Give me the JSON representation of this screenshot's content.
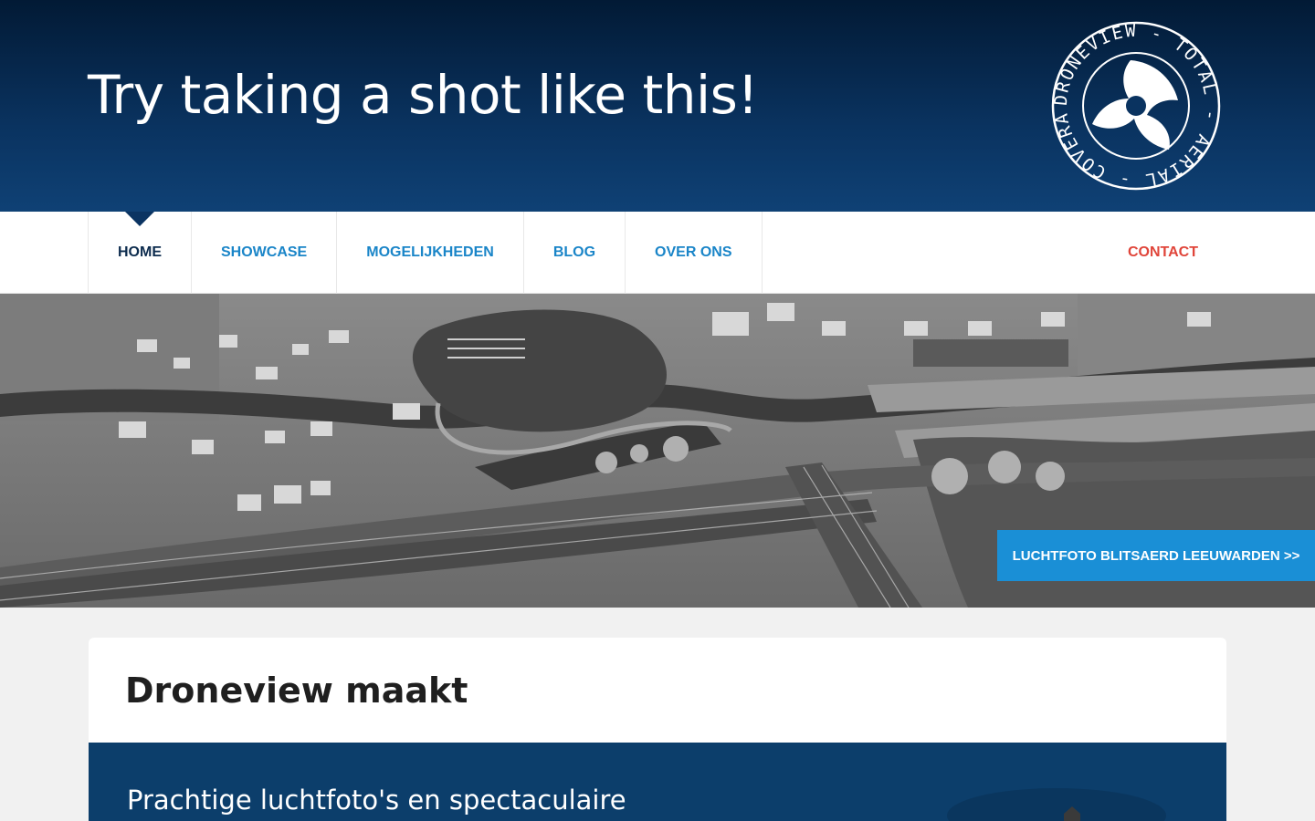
{
  "header": {
    "headline": "Try taking a shot like this!",
    "logo_text": "DRONEVIEW - TOTAL - AERIAL - COVERAGE -"
  },
  "nav": {
    "items": [
      {
        "label": "HOME",
        "active": true
      },
      {
        "label": "SHOWCASE",
        "active": false
      },
      {
        "label": "MOGELIJKHEDEN",
        "active": false
      },
      {
        "label": "BLOG",
        "active": false
      },
      {
        "label": "OVER ONS",
        "active": false
      }
    ],
    "contact": "CONTACT"
  },
  "hero": {
    "cta": "LUCHTFOTO BLITSAERD LEEUWARDEN >>"
  },
  "content": {
    "title": "Droneview maakt",
    "band_text": "Prachtige luchtfoto's en spectaculaire"
  },
  "colors": {
    "header_dark": "#021a35",
    "nav_link": "#1a85c8",
    "nav_active": "#0d2c4e",
    "contact": "#e0453a",
    "cta": "#1a8fd6",
    "band": "#0c3e6b"
  }
}
